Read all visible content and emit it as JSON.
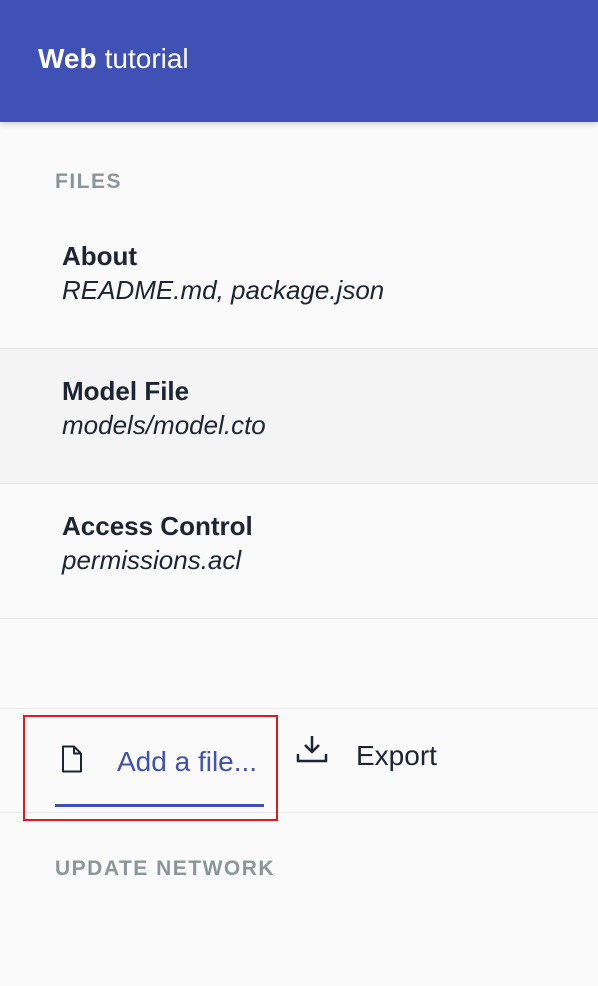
{
  "header": {
    "brand_bold": "Web",
    "brand_light": "tutorial"
  },
  "files_section": {
    "label": "FILES",
    "items": [
      {
        "title": "About",
        "subtitle": "README.md, package.json"
      },
      {
        "title": "Model File",
        "subtitle": "models/model.cto"
      },
      {
        "title": "Access Control",
        "subtitle": "permissions.acl"
      }
    ]
  },
  "actions": {
    "add_file": {
      "label": "Add a file...",
      "icon": "file-icon"
    },
    "export": {
      "label": "Export",
      "icon": "download-icon"
    }
  },
  "update_network": {
    "label": "UPDATE NETWORK"
  },
  "colors": {
    "accent": "#3f51b5",
    "highlight_border": "#e01b1b",
    "section_label": "#8a9699"
  }
}
